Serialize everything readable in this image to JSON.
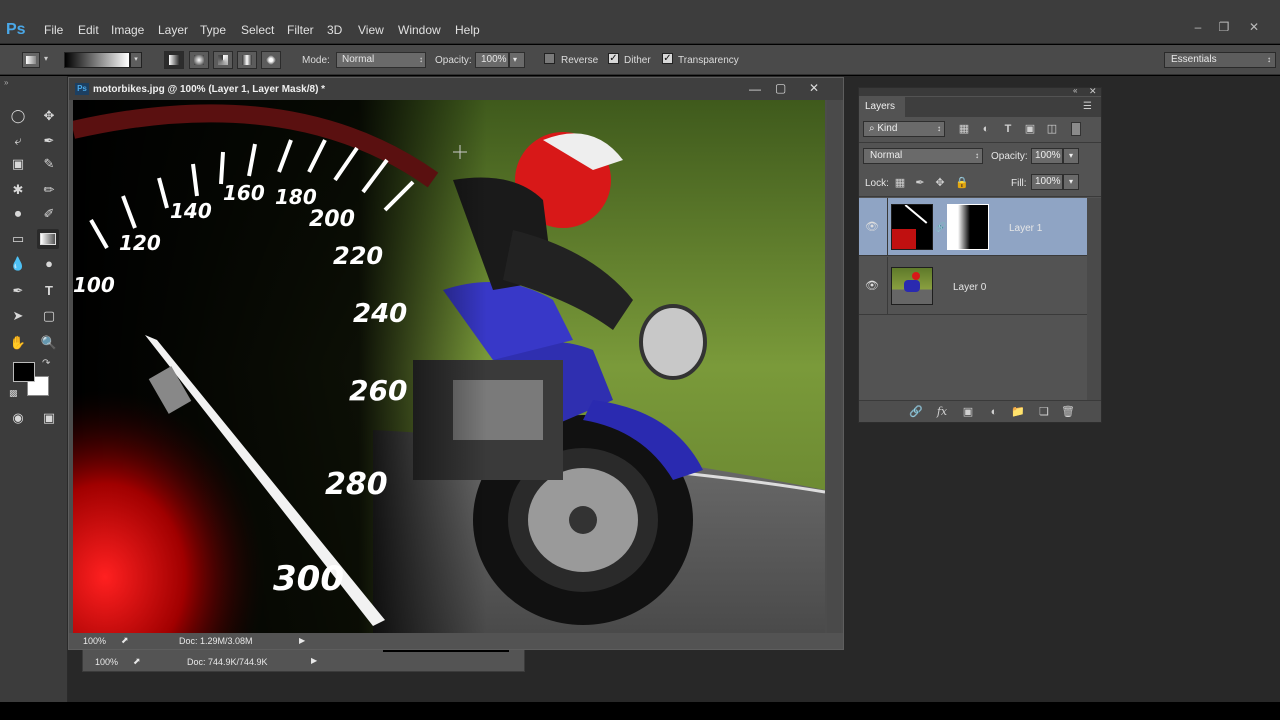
{
  "app": {
    "logo": "Ps",
    "menu": [
      "File",
      "Edit",
      "Image",
      "Layer",
      "Type",
      "Select",
      "Filter",
      "3D",
      "View",
      "Window",
      "Help"
    ],
    "window_controls": [
      "minimize-icon",
      "restore-icon",
      "close-icon"
    ]
  },
  "options_bar": {
    "mode_label": "Mode:",
    "mode_value": "Normal",
    "opacity_label": "Opacity:",
    "opacity_value": "100%",
    "reverse_label": "Reverse",
    "reverse_checked": false,
    "dither_label": "Dither",
    "dither_checked": true,
    "transparency_label": "Transparency",
    "transparency_checked": true,
    "workspace": "Essentials"
  },
  "document": {
    "title": "motorbikes.jpg @ 100% (Layer 1, Layer Mask/8) *",
    "zoom": "100%",
    "doc_size": "Doc: 1.29M/3.08M"
  },
  "document_behind": {
    "zoom": "100%",
    "doc_size": "Doc: 744.9K/744.9K"
  },
  "speedometer": {
    "labels": [
      "100",
      "120",
      "140",
      "160",
      "180",
      "200",
      "220",
      "240",
      "260",
      "280",
      "300"
    ]
  },
  "layers_panel": {
    "tab": "Layers",
    "filter_label": "Kind",
    "blend_mode": "Normal",
    "opacity_label": "Opacity:",
    "opacity_value": "100%",
    "lock_label": "Lock:",
    "fill_label": "Fill:",
    "fill_value": "100%",
    "layers": [
      {
        "name": "Layer 1",
        "selected": true
      },
      {
        "name": "Layer 0",
        "selected": false
      }
    ]
  },
  "colors": {
    "selected_layer": "#8fa4c4",
    "panel_bg": "#535353",
    "menubar_bg": "#3d3d3d"
  }
}
